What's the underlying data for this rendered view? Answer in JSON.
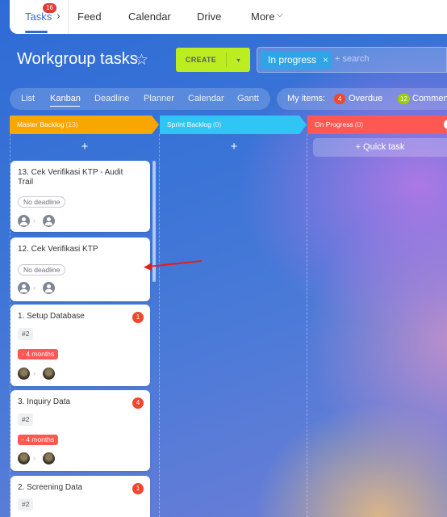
{
  "topnav": {
    "tasks_label": "Tasks",
    "tasks_badge": "16",
    "feed": "Feed",
    "calendar": "Calendar",
    "drive": "Drive",
    "more": "More"
  },
  "header": {
    "title": "Workgroup tasks",
    "create_label": "CREATE",
    "filter_chip": "In progress",
    "search_placeholder": "+ search"
  },
  "views": {
    "list": "List",
    "kanban": "Kanban",
    "deadline": "Deadline",
    "planner": "Planner",
    "calendar": "Calendar",
    "gantt": "Gantt"
  },
  "my_items": {
    "label": "My items:",
    "overdue_count": "4",
    "overdue_label": "Overdue",
    "comments_count": "12",
    "comments_label": "Commen"
  },
  "columns": [
    {
      "name": "Master Backlog",
      "count": "(13)",
      "color": "#f7a700"
    },
    {
      "name": "Sprint Backlog",
      "count": "(0)",
      "color": "#2fc6f6"
    },
    {
      "name": "On Progress",
      "count": "(0)",
      "color": "#ff5752"
    }
  ],
  "quick_task": "+ Quick task",
  "add_symbol": "+",
  "cards": [
    {
      "title": "13. Cek Verifikasi KTP - Audit Trail",
      "deadline": "No deadline"
    },
    {
      "title": "12. Cek Verifikasi KTP",
      "deadline": "No deadline"
    },
    {
      "title": "1. Setup Database",
      "count": "1",
      "tag": "#2",
      "deadline": "- 4 months"
    },
    {
      "title": "3. Inquiry Data",
      "count": "4",
      "tag": "#2",
      "deadline": "- 4 months"
    },
    {
      "title": "2. Screening Data",
      "count": "1",
      "tag": "#2"
    }
  ],
  "colors": {
    "accent": "#2d6ed6",
    "create": "#bbed21",
    "overdue": "#ff5752",
    "annotation_arrow": "#e02020"
  }
}
